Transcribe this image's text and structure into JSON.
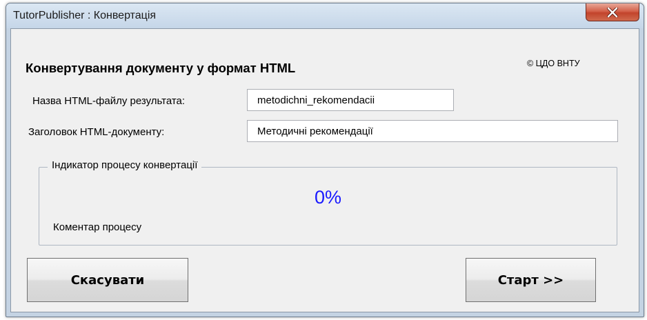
{
  "window": {
    "title": "TutorPublisher : Конвертація",
    "close_icon": "close-x-icon"
  },
  "dialog": {
    "heading": "Конвертування документу у формат HTML",
    "copyright": "© ЦДО ВНТУ"
  },
  "form": {
    "filename_label": "Назва HTML-файлу результата:",
    "filename_value": "metodichni_rekomendacii",
    "doc_title_label": "Заголовок HTML-документу:",
    "doc_title_value": "Методичні рекомендації"
  },
  "progress": {
    "group_label": "Індикатор процесу конвертації",
    "percent_text": "0%",
    "percent": 0,
    "comment": "Коментар процесу"
  },
  "buttons": {
    "cancel_label": "Скасувати",
    "start_label": "Старт >>"
  },
  "colors": {
    "percent": "#1a1aff",
    "close_button": "#c2442c",
    "titlebar": "#c5d6e8"
  }
}
